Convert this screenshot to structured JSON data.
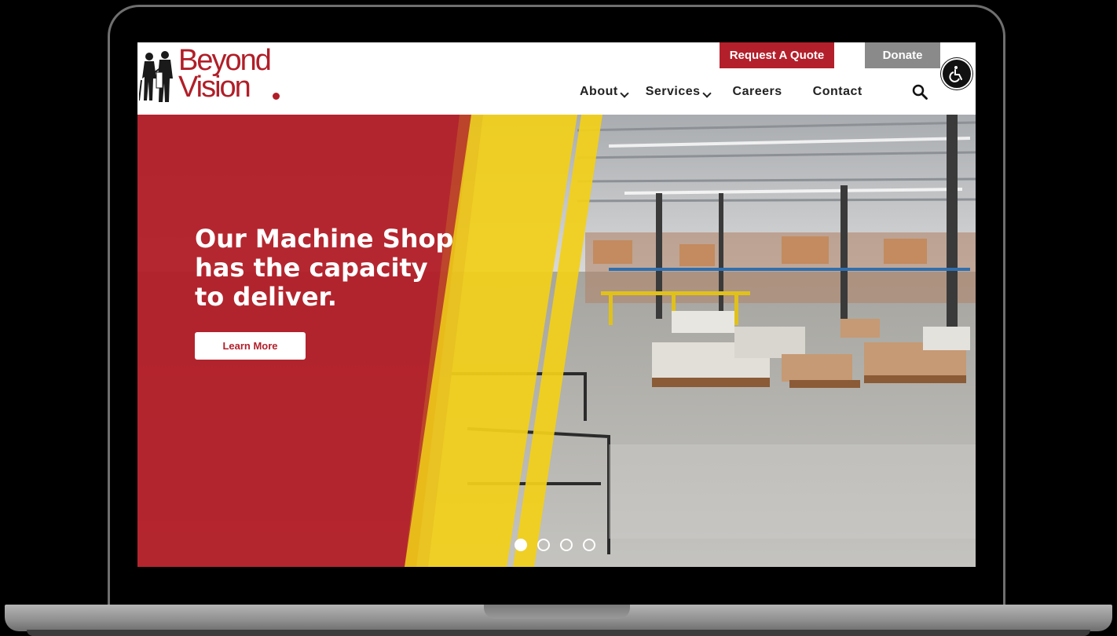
{
  "header": {
    "logo_text_line1": "Beyond",
    "logo_text_line2": "Vision",
    "request_quote_label": "Request A Quote",
    "donate_label": "Donate",
    "accessibility_icon": "wheelchair-icon",
    "search_icon": "search-icon"
  },
  "nav": {
    "items": [
      {
        "label": "About",
        "has_dropdown": true
      },
      {
        "label": "Services",
        "has_dropdown": true
      },
      {
        "label": "Careers",
        "has_dropdown": false
      },
      {
        "label": "Contact",
        "has_dropdown": false
      }
    ]
  },
  "hero": {
    "title_line1": "Our Machine Shop",
    "title_line2": "has the capacity",
    "title_line3": "to deliver.",
    "button_label": "Learn More",
    "slides_total": 4,
    "active_slide": 1
  },
  "colors": {
    "brand_red": "#b3202b",
    "accent_yellow": "#f2cf1a",
    "donate_gray": "#8a8a8a"
  }
}
